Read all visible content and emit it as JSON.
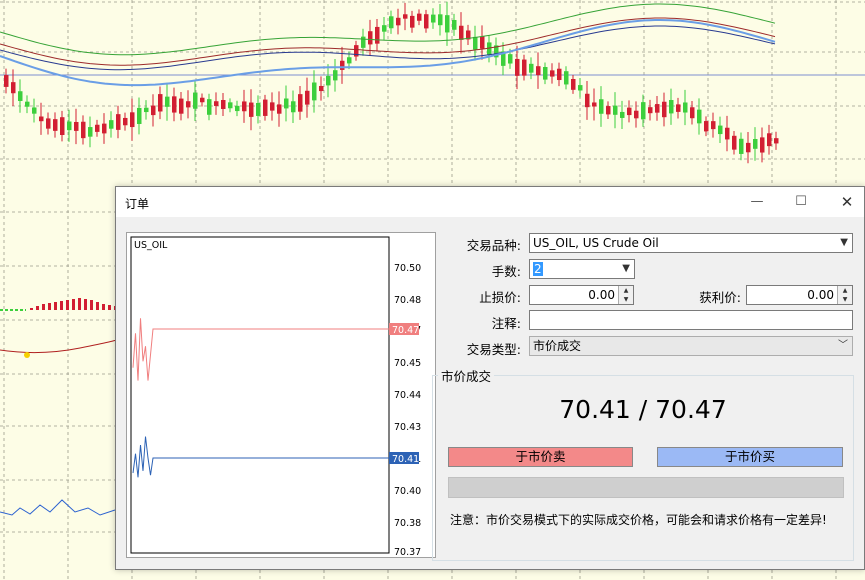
{
  "dialog": {
    "title": "订单",
    "minimize_icon": "minimize-icon",
    "maximize_icon": "maximize-icon",
    "close_icon": "close-icon",
    "close_symbol": "✕",
    "maximize_symbol": "☐",
    "minimize_symbol": "—"
  },
  "tick_chart": {
    "symbol": "US_OIL",
    "price_ticks": [
      "70.50",
      "70.48",
      "70.47",
      "70.45",
      "70.44",
      "70.43",
      "70.41",
      "70.40",
      "70.38",
      "70.37"
    ],
    "ask_label": "70.47",
    "bid_label": "70.41",
    "ask_color": "#f07f7f",
    "bid_color": "#2c62b5",
    "ask_series": [
      70.452,
      70.468,
      70.446,
      70.475,
      70.455,
      70.462,
      70.446,
      70.458,
      70.47,
      70.47,
      70.47
    ],
    "bid_series": [
      70.403,
      70.412,
      70.401,
      70.416,
      70.404,
      70.42,
      70.41,
      70.402,
      70.41,
      70.41,
      70.41
    ]
  },
  "form": {
    "symbol_label": "交易品种:",
    "symbol_value": "US_OIL, US Crude Oil",
    "lots_label": "手数:",
    "lots_value": "2",
    "stoploss_label": "止损价:",
    "stoploss_value": "0.00",
    "takeprofit_label": "获利价:",
    "takeprofit_value": "0.00",
    "comment_label": "注释:",
    "comment_value": "",
    "type_label": "交易类型:",
    "type_value": "市价成交"
  },
  "market": {
    "group_title": "市价成交",
    "prices": "70.41 / 70.47",
    "sell_label": "于市价卖",
    "buy_label": "于市价买",
    "notice": "注意：市价交易模式下的实际成交价格，可能会和请求价格有一定差异!",
    "sell_color": "#f38989",
    "buy_color": "#9bb9f5"
  }
}
